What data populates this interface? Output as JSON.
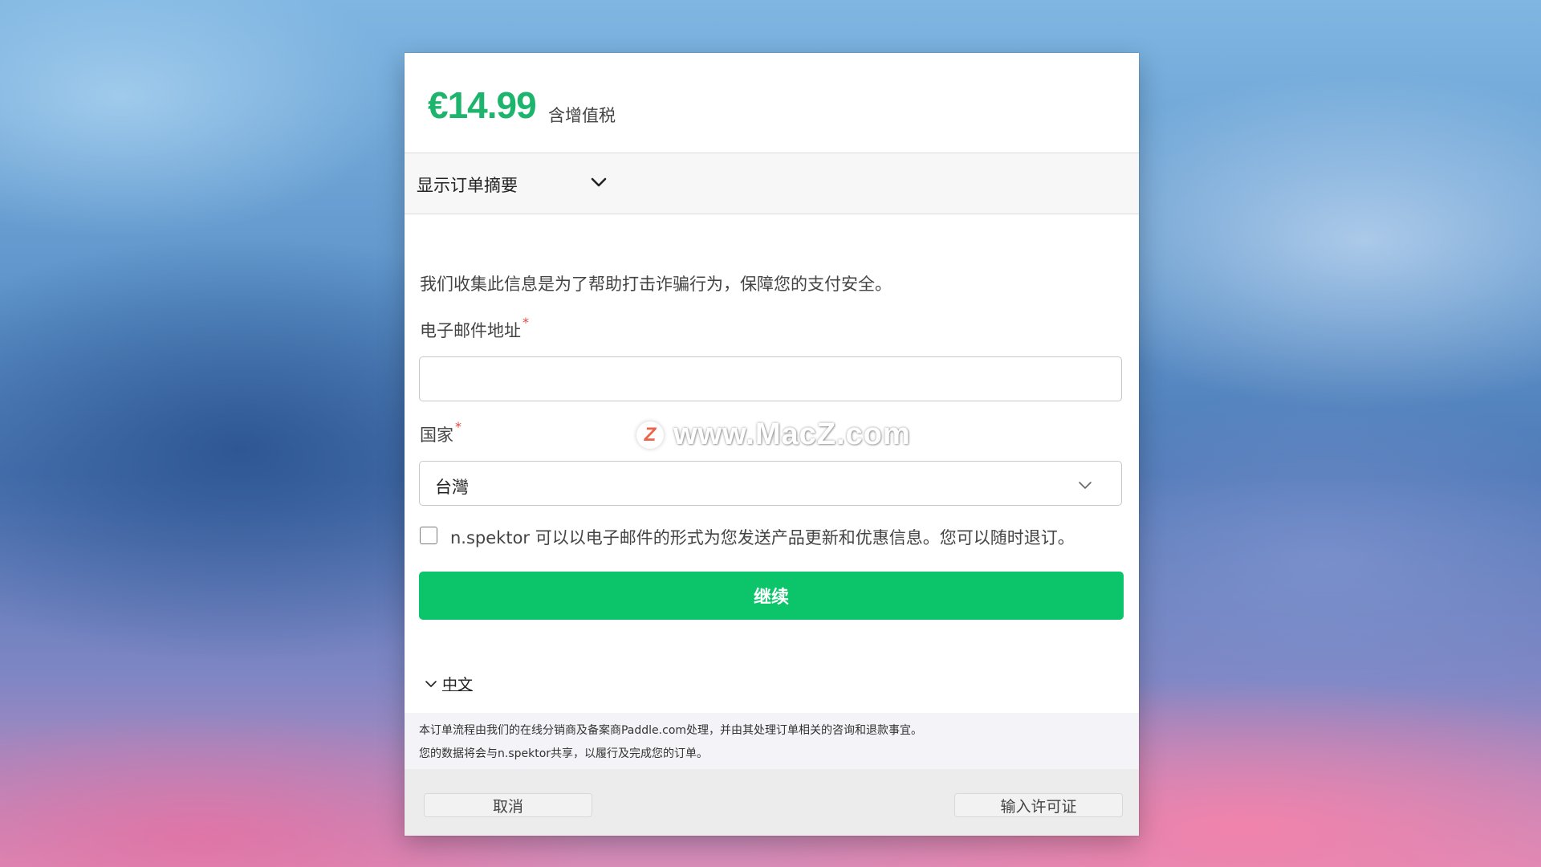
{
  "header": {
    "price": "€14.99",
    "vat_note": "含增值税",
    "price_color": "#1db56d"
  },
  "order_summary": {
    "label": "显示订单摘要",
    "icon": "chevron-down-icon"
  },
  "form": {
    "info_text": "我们收集此信息是为了帮助打击诈骗行为，保障您的支付安全。",
    "email": {
      "label": "电子邮件地址",
      "required_mark": "*",
      "value": ""
    },
    "country": {
      "label": "国家",
      "required_mark": "*",
      "value": "台灣"
    },
    "marketing_opt_in": {
      "checked": false,
      "label": "n.spektor 可以以电子邮件的形式为您发送产品更新和优惠信息。您可以随时退订。"
    },
    "continue_label": "继续",
    "continue_color": "#0cc46a"
  },
  "language": {
    "label": "中文"
  },
  "footer": {
    "line1": "本订单流程由我们的在线分销商及备案商Paddle.com处理，并由其处理订单相关的咨询和退款事宜。",
    "line2": "您的数据将会与n.spektor共享，以履行及完成您的订单。",
    "cancel_label": "取消",
    "license_label": "输入许可证"
  },
  "watermark": {
    "logo_letter": "Z",
    "text": "www.MacZ.com"
  }
}
